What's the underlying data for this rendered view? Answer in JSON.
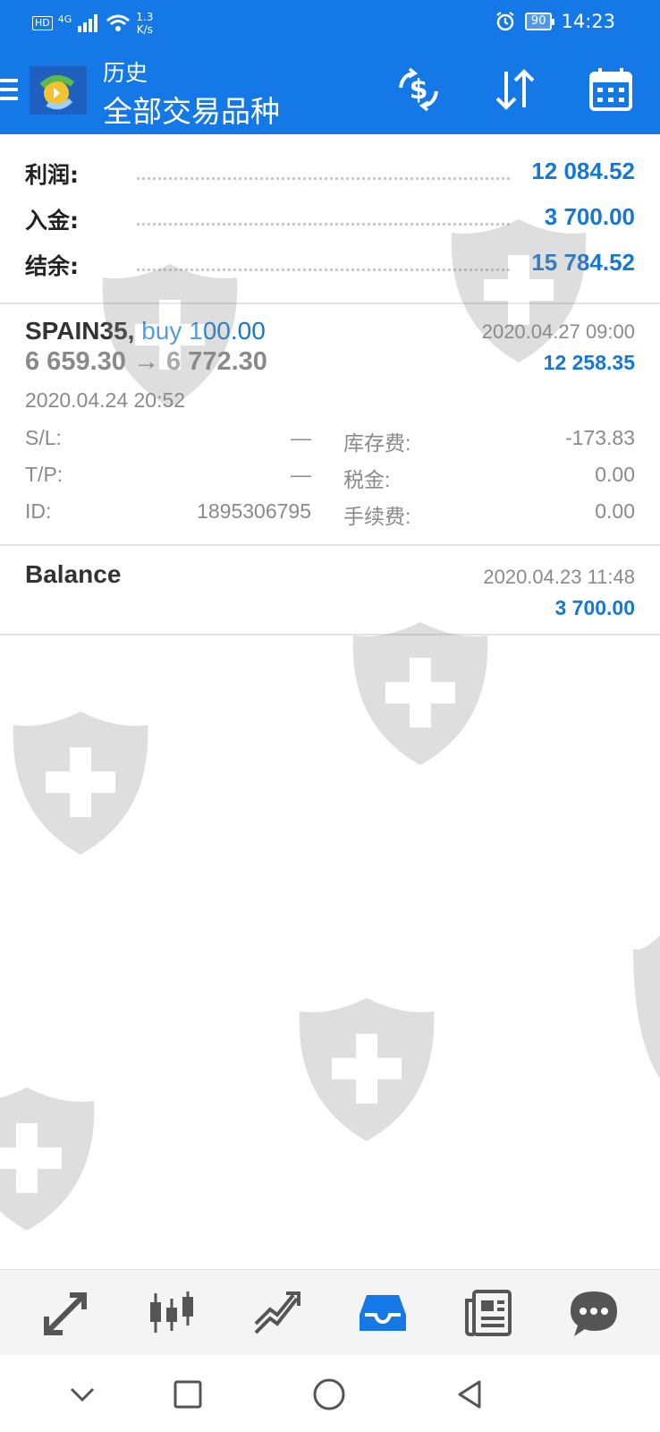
{
  "status_bar": {
    "hd": "HD",
    "network": "4G",
    "speed_value": "1.3",
    "speed_unit": "K/s",
    "battery": "90",
    "time": "14:23"
  },
  "header": {
    "subtitle": "历史",
    "title": "全部交易品种",
    "background_color": "#1478e6",
    "icons": [
      "currency-exchange-icon",
      "sort-icon",
      "calendar-icon"
    ]
  },
  "summary": {
    "rows": [
      {
        "label": "利润:",
        "value": "12 084.52"
      },
      {
        "label": "入金:",
        "value": "3 700.00"
      },
      {
        "label": "结余:",
        "value": "15 784.52"
      }
    ],
    "value_color": "#1478d4"
  },
  "trade": {
    "symbol": "SPAIN35,",
    "side": "buy 100.00",
    "price_range": "6 659.30 → 6 772.30",
    "close_time": "2020.04.27 09:00",
    "profit": "12 258.35",
    "open_time": "2020.04.24 20:52",
    "details_left": [
      {
        "label": "S/L:",
        "value": "—"
      },
      {
        "label": "T/P:",
        "value": "—"
      },
      {
        "label": "ID:",
        "value": "1895306795"
      }
    ],
    "details_right": [
      {
        "label": "库存费:",
        "value": "-173.83"
      },
      {
        "label": "税金:",
        "value": "0.00"
      },
      {
        "label": "手续费:",
        "value": "0.00"
      }
    ]
  },
  "balance": {
    "label": "Balance",
    "time": "2020.04.23 11:48",
    "amount": "3 700.00"
  },
  "bottom_nav": {
    "items": [
      "quotes-icon",
      "chart-icon",
      "trade-icon",
      "history-icon",
      "news-icon",
      "chat-icon"
    ],
    "active": "history-icon",
    "active_color": "#1478e6"
  },
  "system_nav": [
    "back-chevron-icon",
    "recents-square-icon",
    "home-circle-icon",
    "back-triangle-icon"
  ]
}
